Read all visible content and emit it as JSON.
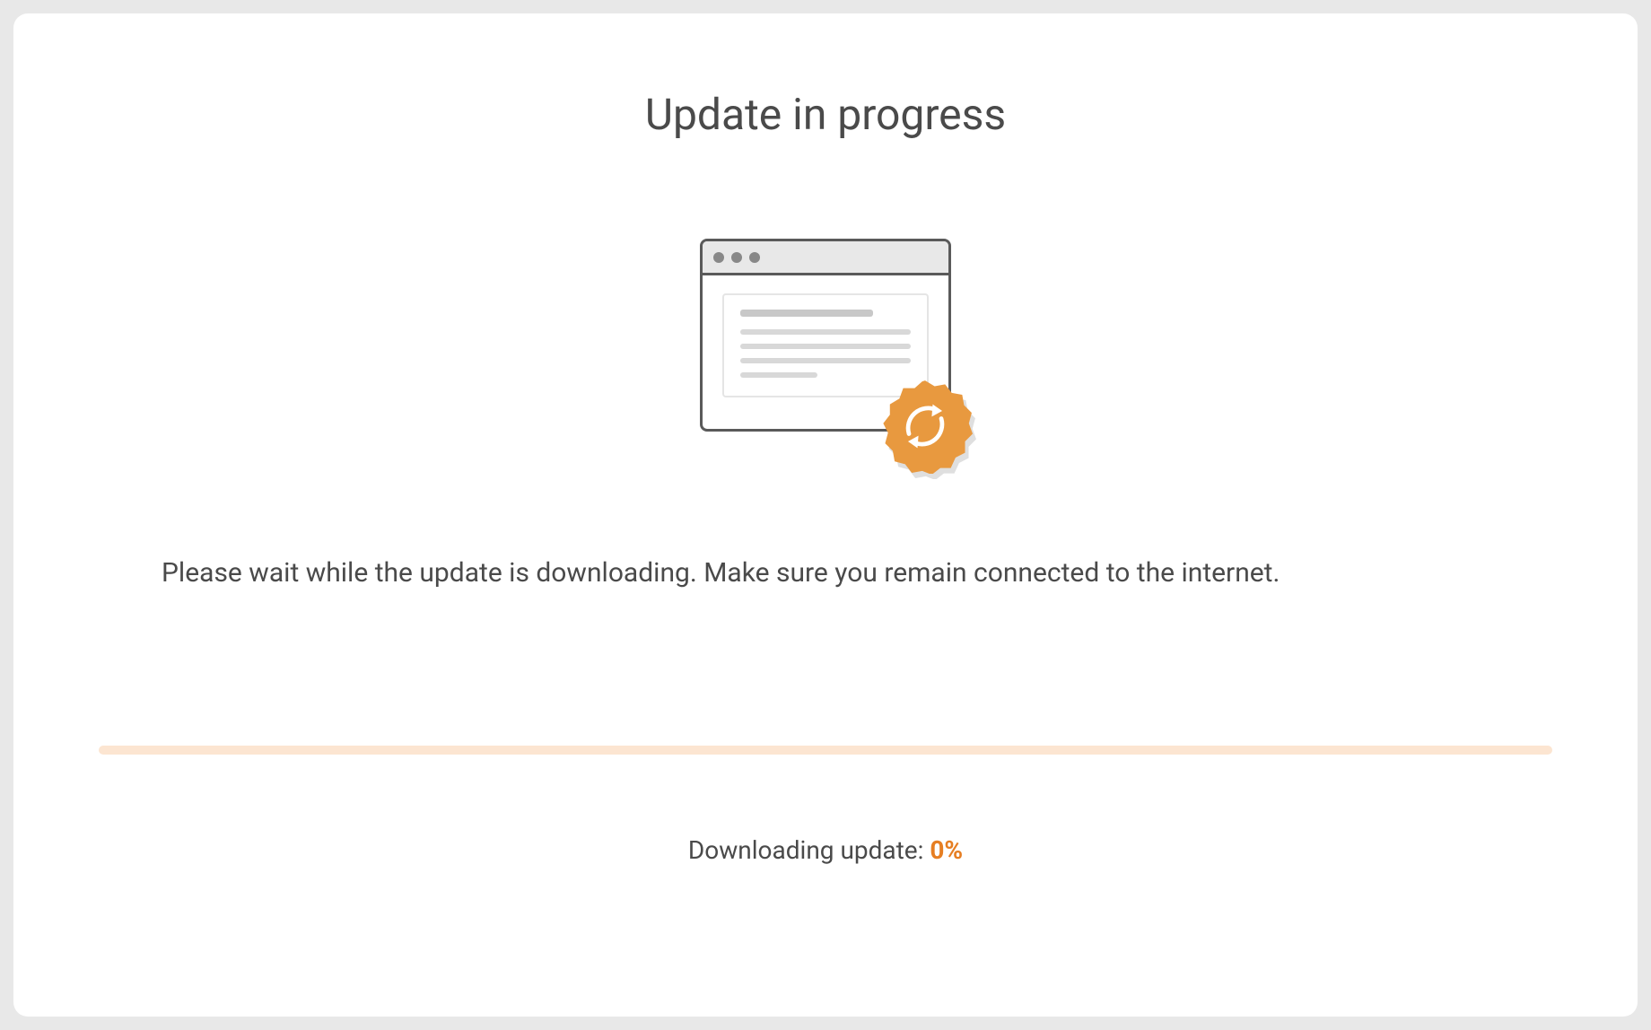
{
  "title": "Update in progress",
  "description": "Please wait while the update is downloading. Make sure you remain connected to the internet.",
  "status": {
    "label": "Downloading update: ",
    "percent_text": "0%",
    "percent_value": 0
  },
  "colors": {
    "accent": "#e67e22",
    "progress_track": "#fce5d1"
  },
  "icons": {
    "illustration": "browser-window-with-sync-badge",
    "badge": "sync-refresh-icon"
  }
}
